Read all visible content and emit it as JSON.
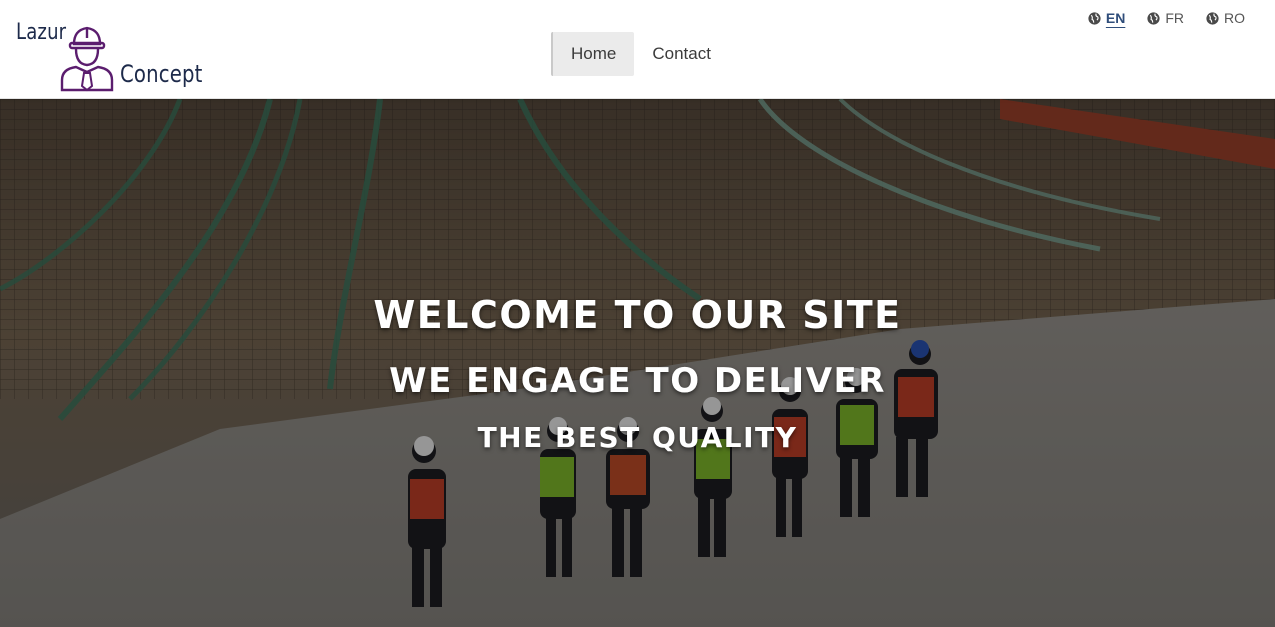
{
  "brand": {
    "name_top": "Lazur",
    "name_bottom": "Concept",
    "accent_color": "#5b1d6e",
    "text_color": "#1d2a4a",
    "icon": "worker-helmet-icon"
  },
  "nav": {
    "items": [
      {
        "label": "Home",
        "active": true
      },
      {
        "label": "Contact",
        "active": false
      }
    ]
  },
  "languages": [
    {
      "code": "EN",
      "icon": "globe-icon",
      "active": true
    },
    {
      "code": "FR",
      "icon": "globe-icon",
      "active": false
    },
    {
      "code": "RO",
      "icon": "globe-icon",
      "active": false
    }
  ],
  "hero": {
    "line1": "WELCOME TO OUR SITE",
    "line2": "WE ENGAGE TO DELIVER",
    "line3": "THE BEST QUALITY",
    "background": "construction-site-photo"
  }
}
